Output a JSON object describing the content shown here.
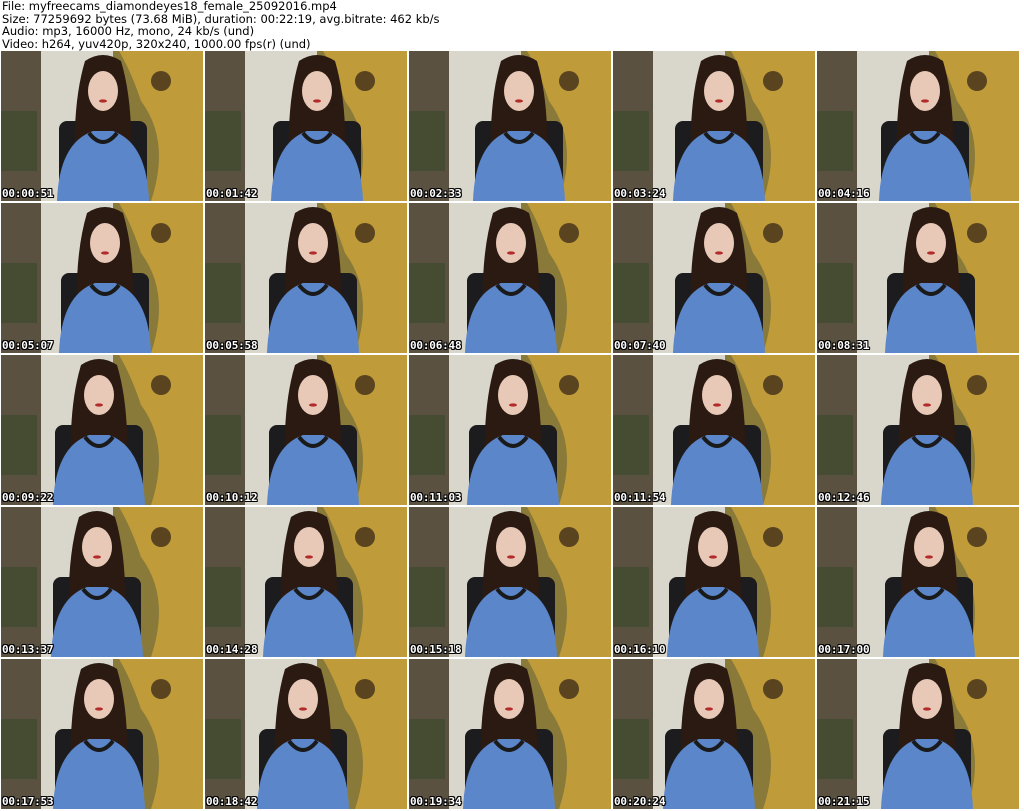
{
  "header": {
    "line1": "File: myfreecams_diamondeyes18_female_25092016.mp4",
    "line2": "Size: 77259692 bytes (73.68 MiB), duration: 00:22:19, avg.bitrate: 462 kb/s",
    "line3": "Audio: mp3, 16000 Hz, mono, 24 kb/s (und)",
    "line4": "Video: h264, yuv420p, 320x240, 1000.00 fps(r) (und)"
  },
  "thumbnails": [
    {
      "timestamp": "00:00:51"
    },
    {
      "timestamp": "00:01:42"
    },
    {
      "timestamp": "00:02:33"
    },
    {
      "timestamp": "00:03:24"
    },
    {
      "timestamp": "00:04:16"
    },
    {
      "timestamp": "00:05:07"
    },
    {
      "timestamp": "00:05:58"
    },
    {
      "timestamp": "00:06:48"
    },
    {
      "timestamp": "00:07:40"
    },
    {
      "timestamp": "00:08:31"
    },
    {
      "timestamp": "00:09:22"
    },
    {
      "timestamp": "00:10:12"
    },
    {
      "timestamp": "00:11:03"
    },
    {
      "timestamp": "00:11:54"
    },
    {
      "timestamp": "00:12:46"
    },
    {
      "timestamp": "00:13:37"
    },
    {
      "timestamp": "00:14:28"
    },
    {
      "timestamp": "00:15:18"
    },
    {
      "timestamp": "00:16:10"
    },
    {
      "timestamp": "00:17:00"
    },
    {
      "timestamp": "00:17:53"
    },
    {
      "timestamp": "00:18:42"
    },
    {
      "timestamp": "00:19:34"
    },
    {
      "timestamp": "00:20:24"
    },
    {
      "timestamp": "00:21:15"
    }
  ],
  "colors": {
    "wall": "#d9d6cc",
    "painting_gold": "#c8a23a",
    "shirt_blue": "#5b86c9",
    "hair": "#2a1a12",
    "chair": "#1c1c1e"
  }
}
